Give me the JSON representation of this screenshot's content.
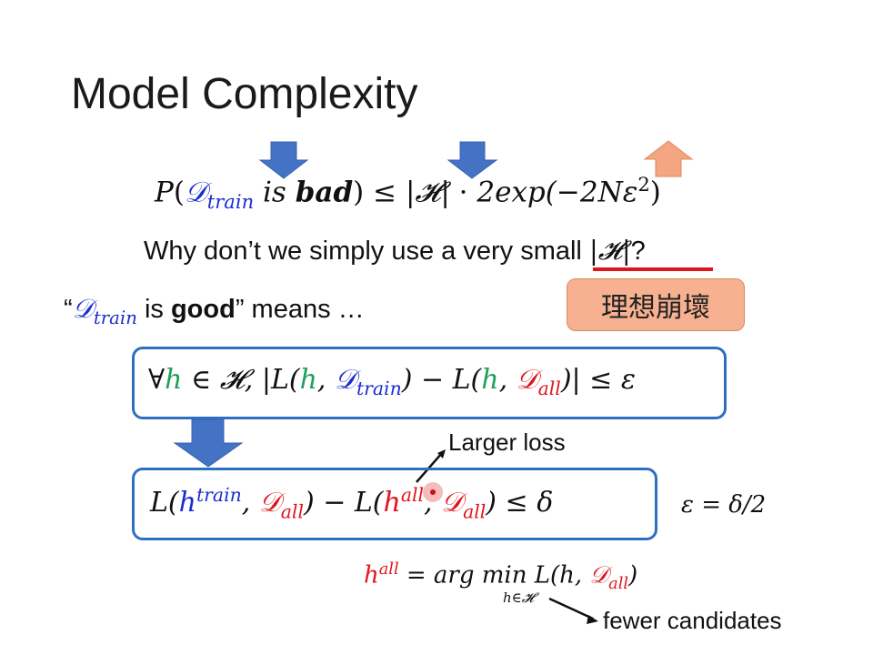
{
  "title": "Model Complexity",
  "eq_main": {
    "P": "P",
    "open": "(",
    "D": "𝒟",
    "train": "train",
    "is": "is",
    "bad": "bad",
    "close": ")",
    "leq": " ≤ ",
    "H": "|𝓗|",
    "dot": " · ",
    "rest": "2exp(−2Nε",
    "sq": "2",
    "end": ")"
  },
  "question": {
    "text": "Why don’t we simply use a very small ",
    "H": "|𝓗|",
    "q": "?"
  },
  "good_line": {
    "open_quote": "“",
    "D": "𝒟",
    "train": "train",
    "is": " is ",
    "good": "good",
    "rest": "” means …"
  },
  "collapse_label": "理想崩壞",
  "box1": {
    "forall": "∀",
    "h": "h",
    "in": " ∈ 𝓗, |L(",
    "h2": "h",
    "comma": ", ",
    "D": "𝒟",
    "train": "train",
    "mid": ") − L(",
    "h3": "h",
    "comma2": ", ",
    "D2": "𝒟",
    "all": "all",
    "end": ")| ≤ ε"
  },
  "box2": {
    "L": "L(",
    "h": "h",
    "train": "train",
    "comma": ", ",
    "D": "𝒟",
    "all": "all",
    "mid": ") − L(",
    "h2": "h",
    "all2": "all",
    "comma2": ", ",
    "D2": "𝒟",
    "all3": "all",
    "end": ") ≤ δ"
  },
  "eps_note": "ε = δ/2",
  "larger_loss": "Larger loss",
  "hall_def": {
    "h": "h",
    "all": "all",
    "eq": " = arg min L(h, ",
    "D": "𝒟",
    "all2": "all",
    "end": ")",
    "sub": "h∈𝓗"
  },
  "fewer_candidates": "fewer candidates",
  "colors": {
    "blue": "#1a2ed0",
    "green": "#1fa05a",
    "red": "#e0141c",
    "arrow_blue": "#4472c4",
    "arrow_orange": "#f4a582",
    "frame": "#2f6fc1"
  }
}
